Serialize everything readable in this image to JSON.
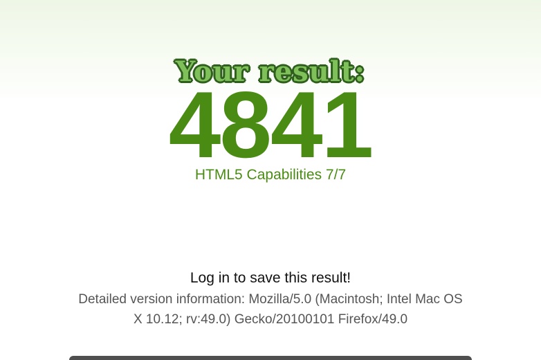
{
  "result": {
    "headline": "Your result:",
    "score": "4841",
    "capabilities": "HTML5 Capabilities 7/7"
  },
  "account": {
    "login_prompt": "Log in to save this result!"
  },
  "version": {
    "details": "Detailed version information: Mozilla/5.0 (Macintosh; Intel Mac OS X 10.12; rv:49.0) Gecko/20100101 Firefox/49.0"
  },
  "colors": {
    "accent_green": "#4a8c13",
    "headline_fill": "#7fc05a",
    "headline_outline": "#2f5f1c",
    "body_text": "#111111",
    "muted_text": "#555555"
  }
}
